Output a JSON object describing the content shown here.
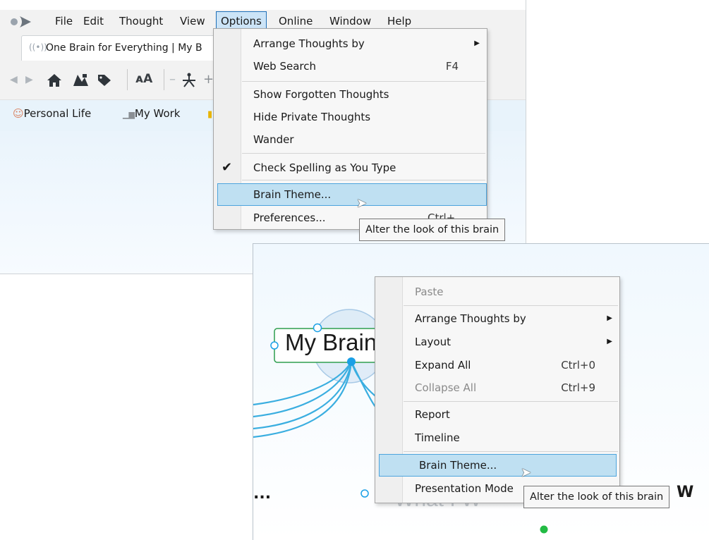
{
  "top_window": {
    "menubar": [
      "File",
      "Edit",
      "Thought",
      "View",
      "Options",
      "Online",
      "Window",
      "Help"
    ],
    "active_menu": "Options",
    "tab": {
      "title": "One Brain for Everything | My B"
    },
    "pins": [
      "Personal Life",
      "My Work"
    ],
    "options_menu": {
      "items": [
        {
          "label": "Arrange Thoughts by",
          "submenu": true
        },
        {
          "label": "Web Search",
          "shortcut": "F4"
        },
        {
          "label": "Show Forgotten Thoughts"
        },
        {
          "label": "Hide Private Thoughts"
        },
        {
          "label": "Wander"
        },
        {
          "label": "Check Spelling as You Type",
          "checked": true
        },
        {
          "label": "Brain Theme...",
          "highlighted": true
        },
        {
          "label": "Preferences...",
          "shortcut": "Ctrl+,"
        }
      ]
    },
    "tooltip": "Alter the look of this brain"
  },
  "bottom_window": {
    "node": "My Brain",
    "partial_text": "...",
    "partial_w": "W",
    "context_menu": {
      "items": [
        {
          "label": "Paste",
          "disabled": true
        },
        {
          "label": "Arrange Thoughts by",
          "submenu": true
        },
        {
          "label": "Layout",
          "submenu": true
        },
        {
          "label": "Expand All",
          "shortcut": "Ctrl+0"
        },
        {
          "label": "Collapse All",
          "shortcut": "Ctrl+9",
          "disabled": true
        },
        {
          "label": "Report"
        },
        {
          "label": "Timeline"
        },
        {
          "label": "Brain Theme...",
          "highlighted": true
        },
        {
          "label": "Presentation Mode"
        }
      ]
    },
    "tooltip": "Alter the look of this brain"
  },
  "colors": {
    "highlight": "#bfe0f2",
    "highlight_border": "#4da4dd",
    "link_line": "#3aaee0",
    "node_border": "#2e9e4f",
    "accent_dot": "#1aa0e6"
  },
  "icons": [
    "app-logo-icon",
    "back-icon",
    "forward-icon",
    "home-icon",
    "map-icon",
    "tag-icon",
    "font-size-icon",
    "network-icon",
    "personal-life-icon",
    "my-work-icon",
    "checkmark-icon",
    "submenu-arrow-icon",
    "mouse-cursor-icon"
  ]
}
